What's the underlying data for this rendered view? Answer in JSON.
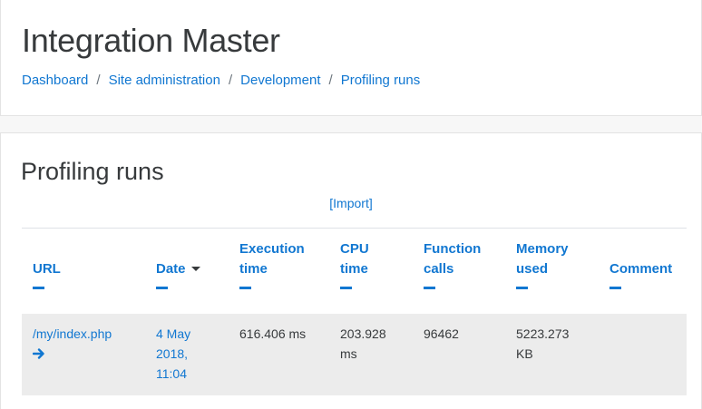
{
  "header": {
    "site_title": "Integration Master",
    "breadcrumb": [
      "Dashboard",
      "Site administration",
      "Development",
      "Profiling runs"
    ],
    "separator": "/"
  },
  "main": {
    "heading": "Profiling runs",
    "import_label": "[Import]",
    "table": {
      "columns": [
        "URL",
        "Date",
        "Execution time",
        "CPU time",
        "Function calls",
        "Memory used",
        "Comment"
      ],
      "sorted_column": "Date",
      "rows": [
        {
          "url": "/my/index.php",
          "date": "4 May 2018, 11:04",
          "execution_time": "616.406 ms",
          "cpu_time": "203.928 ms",
          "function_calls": "96462",
          "memory_used": "5223.273 KB",
          "comment": ""
        }
      ]
    }
  },
  "colors": {
    "link": "#1177d1",
    "row_bg": "#ececec",
    "page_bg": "#f7f7f7"
  },
  "icons": {
    "sort": "caret-down-icon",
    "open_run": "arrow-right-icon",
    "collapse": "minus-icon"
  }
}
